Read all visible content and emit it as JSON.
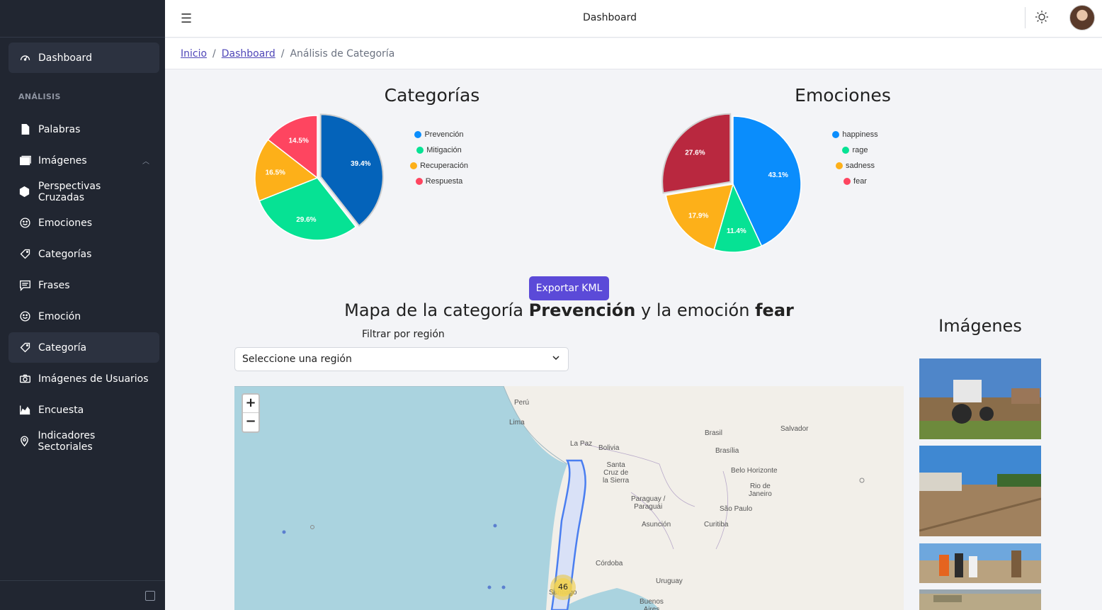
{
  "sidebar": {
    "items": [
      {
        "label": "Dashboard",
        "icon": "speedometer-icon"
      },
      {
        "label": "Palabras",
        "icon": "file-icon"
      },
      {
        "label": "Imágenes",
        "icon": "images-icon"
      },
      {
        "label": "Perspectivas Cruzadas",
        "icon": "cube-icon"
      },
      {
        "label": "Emociones",
        "icon": "smile-icon"
      },
      {
        "label": "Categorías",
        "icon": "tag-icon"
      },
      {
        "label": "Frases",
        "icon": "comment-icon"
      },
      {
        "label": "Emoción",
        "icon": "smile-icon"
      },
      {
        "label": "Categoría",
        "icon": "tag-icon"
      },
      {
        "label": "Imágenes de Usuarios",
        "icon": "camera-icon"
      },
      {
        "label": "Encuesta",
        "icon": "chart-area-icon"
      },
      {
        "label": "Indicadores Sectoriales",
        "icon": "map-pin-icon"
      }
    ],
    "section_title": "ANÁLISIS"
  },
  "header": {
    "title": "Dashboard",
    "menu_icon": "hamburger-icon",
    "theme_icon": "sun-icon"
  },
  "breadcrumb": {
    "home": "Inicio",
    "section": "Dashboard",
    "current": "Análisis de Categoría",
    "separator": "/"
  },
  "charts_title": {
    "categories": "Categorías",
    "emotions": "Emociones"
  },
  "chart_data": [
    {
      "type": "pie",
      "title": "Categorías",
      "categories": [
        "Prevención",
        "Mitigación",
        "Recuperación",
        "Respuesta"
      ],
      "values": [
        39.4,
        29.6,
        16.5,
        14.5
      ],
      "labels": [
        "39.4%",
        "29.6%",
        "16.5%",
        "14.5%"
      ],
      "colors": [
        "#0463ba",
        "#06e294",
        "#fdb019",
        "#fe4560"
      ],
      "legend_colors": [
        "#0a8dfc",
        "#06e294",
        "#fdb019",
        "#fe4560"
      ],
      "highlighted": "Prevención",
      "legend_position": "right"
    },
    {
      "type": "pie",
      "title": "Emociones",
      "categories": [
        "happiness",
        "rage",
        "sadness",
        "fear"
      ],
      "values": [
        43.1,
        11.4,
        17.9,
        27.6
      ],
      "labels": [
        "43.1%",
        "11.4%",
        "17.9%",
        "27.6%"
      ],
      "colors": [
        "#0a8dfc",
        "#06e294",
        "#fdb019",
        "#b9283f"
      ],
      "legend_colors": [
        "#0a8dfc",
        "#06e294",
        "#fdb019",
        "#fe4560"
      ],
      "highlighted": "fear",
      "legend_position": "right"
    }
  ],
  "export_button": "Exportar KML",
  "map_section": {
    "title_prefix": "Mapa de la categoría",
    "category": "Prevención",
    "title_middle": "y la emoción",
    "emotion": "fear",
    "filter_label": "Filtrar por región",
    "select_value": "Seleccione una región",
    "zoom_in": "+",
    "zoom_out": "−",
    "cluster_count": "46",
    "labels": {
      "peru": "Perú",
      "lima": "Lima",
      "brasil": "Brasil",
      "salvador": "Salvador",
      "lapaz": "La Paz",
      "bolivia": "Bolivia",
      "brasilia": "Brasília",
      "santacruz": "Santa\nCruz de\nla Sierra",
      "belo": "Belo Horizonte",
      "rio": "Rio de\nJaneiro",
      "paraguay": "Paraguay /\nParaguái",
      "saopaulo": "São Paulo",
      "asuncion": "Asunción",
      "curitiba": "Curitiba",
      "cordoba": "Córdoba",
      "uruguay": "Uruguay",
      "santiago": "Santiago",
      "buenos": "Buenos\nAires"
    }
  },
  "images_section": {
    "title": "Imágenes",
    "images": [
      "tractor-field-photo",
      "plowed-field-photo",
      "people-outdoors-photo",
      "dry-field-photo"
    ]
  }
}
